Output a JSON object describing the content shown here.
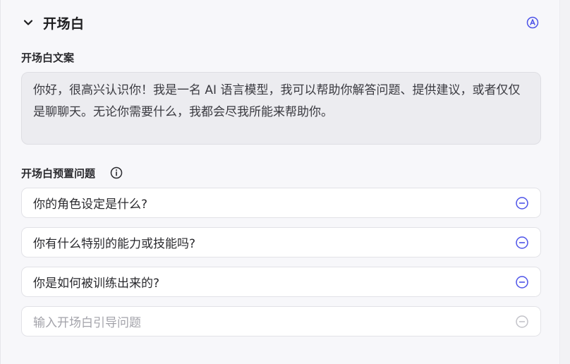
{
  "section": {
    "title": "开场白",
    "collapse_icon": "chevron-down-icon",
    "auto_icon": "auto-generate-icon"
  },
  "opening_copy": {
    "label": "开场白文案",
    "text": "你好，很高兴认识你！我是一名 AI 语言模型，我可以帮助你解答问题、提供建议，或者仅仅是聊聊天。无论你需要什么，我都会尽我所能来帮助你。"
  },
  "preset_questions": {
    "label": "开场白预置问题",
    "info_icon": "info-icon",
    "items": [
      {
        "text": "你的角色设定是什么?"
      },
      {
        "text": "你有什么特别的能力或技能吗?"
      },
      {
        "text": "你是如何被训练出来的?"
      }
    ],
    "new_placeholder": "输入开场白引导问题"
  },
  "colors": {
    "accent": "#4d53e8",
    "disabled": "#c3c3c9"
  }
}
